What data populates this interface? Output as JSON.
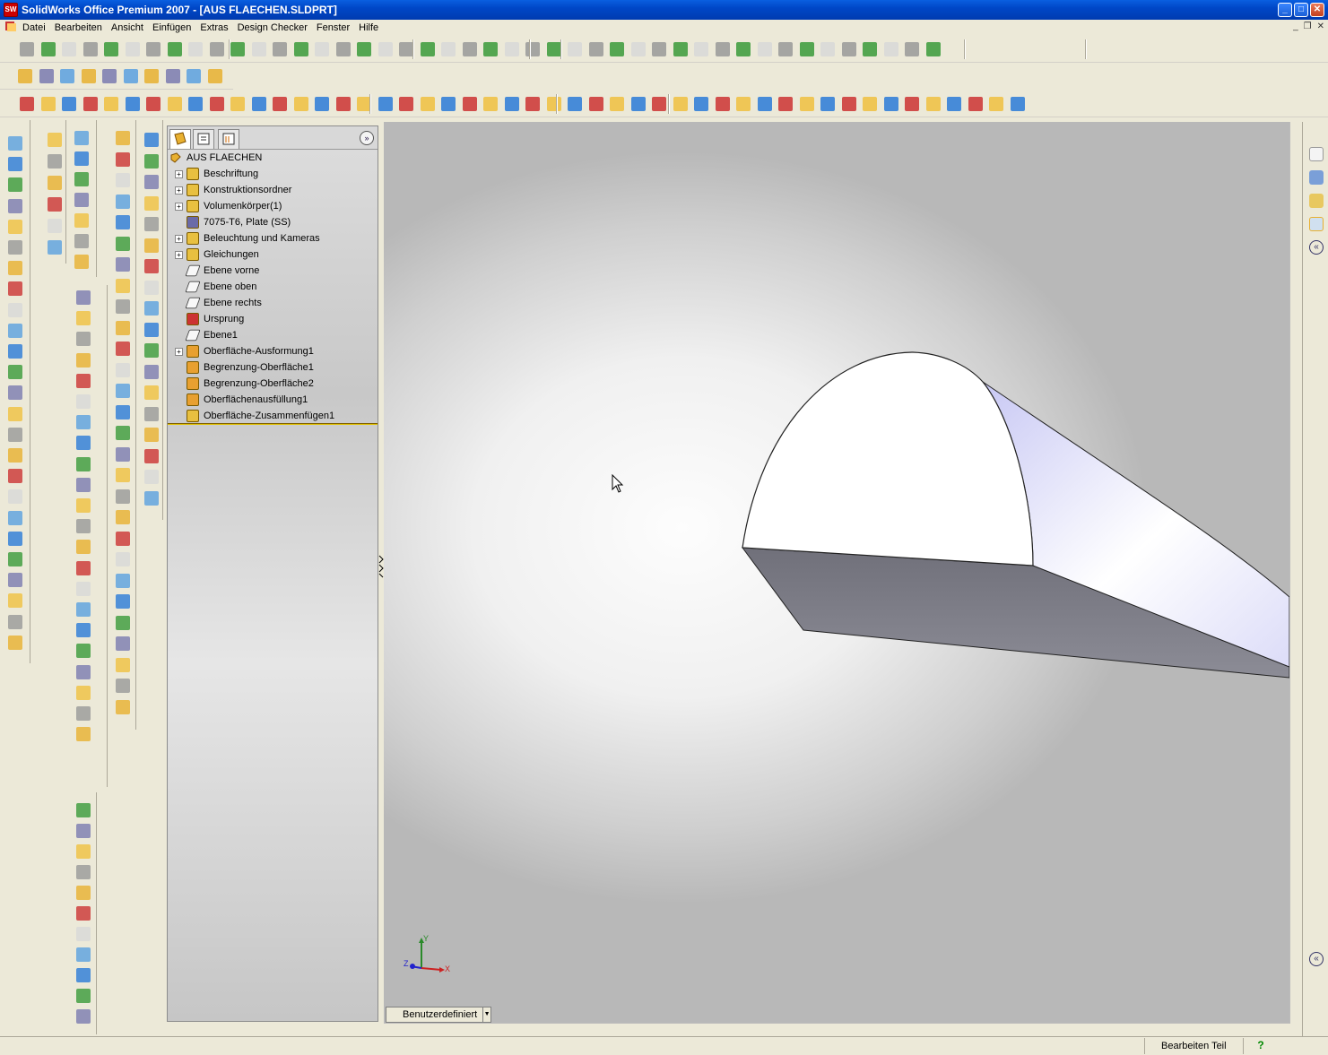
{
  "window": {
    "title": "SolidWorks Office Premium 2007 - [AUS FLAECHEN.SLDPRT]",
    "app_icon_label": "SW",
    "minimize": "_",
    "maximize": "□",
    "close": "✕"
  },
  "menu": {
    "items": [
      "Datei",
      "Bearbeiten",
      "Ansicht",
      "Einfügen",
      "Extras",
      "Design Checker",
      "Fenster",
      "Hilfe"
    ]
  },
  "feature_manager": {
    "root": "AUS FLAECHEN",
    "items": [
      {
        "label": "Beschriftung",
        "expandable": true,
        "icon": "annotation-icon"
      },
      {
        "label": "Konstruktionsordner",
        "expandable": true,
        "icon": "design-binder-icon"
      },
      {
        "label": "Volumenkörper(1)",
        "expandable": true,
        "icon": "solid-bodies-icon"
      },
      {
        "label": "7075-T6, Plate (SS)",
        "expandable": false,
        "icon": "material-icon"
      },
      {
        "label": "Beleuchtung und Kameras",
        "expandable": true,
        "icon": "lights-icon"
      },
      {
        "label": "Gleichungen",
        "expandable": true,
        "icon": "equations-icon"
      },
      {
        "label": "Ebene vorne",
        "expandable": false,
        "icon": "plane-icon"
      },
      {
        "label": "Ebene oben",
        "expandable": false,
        "icon": "plane-icon"
      },
      {
        "label": "Ebene rechts",
        "expandable": false,
        "icon": "plane-icon"
      },
      {
        "label": "Ursprung",
        "expandable": false,
        "icon": "origin-icon"
      },
      {
        "label": "Ebene1",
        "expandable": false,
        "icon": "plane-icon"
      },
      {
        "label": "Oberfläche-Ausformung1",
        "expandable": true,
        "icon": "surface-loft-icon"
      },
      {
        "label": "Begrenzung-Oberfläche1",
        "expandable": false,
        "icon": "boundary-surface-icon"
      },
      {
        "label": "Begrenzung-Oberfläche2",
        "expandable": false,
        "icon": "boundary-surface-icon"
      },
      {
        "label": "Oberflächenausfüllung1",
        "expandable": false,
        "icon": "filled-surface-icon"
      },
      {
        "label": "Oberfläche-Zusammenfügen1",
        "expandable": false,
        "icon": "knit-surface-icon"
      }
    ],
    "expand_label": "»"
  },
  "viewport": {
    "configuration": "Benutzerdefiniert",
    "triad": {
      "x": "X",
      "y": "Y",
      "z": "Z"
    }
  },
  "status": {
    "mode": "Bearbeiten Teil",
    "help": "?"
  },
  "colors": {
    "accent": "#0047c7",
    "rollback_bar": "#e0c000",
    "model_top": "#ffffff",
    "model_side": "#7c7c86",
    "model_curved": "#d8d8f8"
  }
}
